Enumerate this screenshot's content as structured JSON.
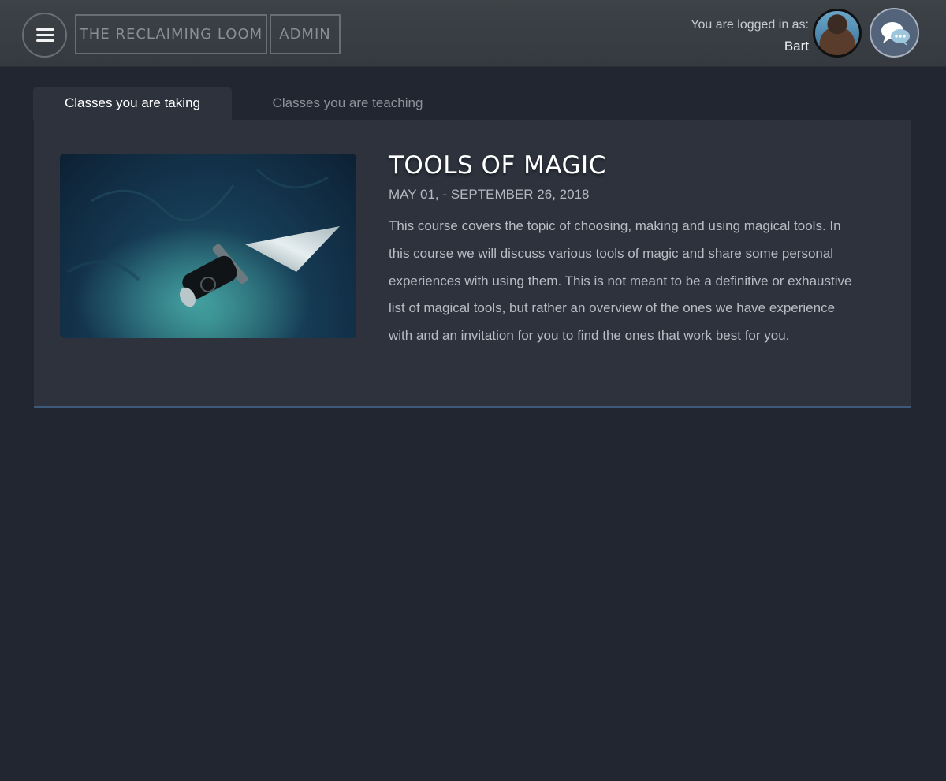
{
  "header": {
    "menu_icon": "hamburger-menu-icon",
    "brand_label": "THE RECLAIMING LOOM",
    "admin_label": "ADMIN",
    "login_label": "You are logged in as:",
    "user_name": "Bart",
    "chat_icon": "chat-bubbles-icon"
  },
  "tabs": [
    {
      "label": "Classes you are taking",
      "active": true
    },
    {
      "label": "Classes you are teaching",
      "active": false
    }
  ],
  "course": {
    "title": "TOOLS OF MAGIC",
    "dates": "MAY 01, - SEPTEMBER 26, 2018",
    "description": "This course covers the topic of choosing, making and using magical tools. In this course we will discuss various tools of magic and share some personal experiences with using them. This is not meant to be a definitive or exhaustive list of magical tools, but rather an overview of the ones we have experience with and an invitation for you to find the ones that work best for you."
  },
  "colors": {
    "background": "#212630",
    "panel": "#2d323d",
    "header": "#3a3f44",
    "accent_border": "#3e5a7a"
  }
}
